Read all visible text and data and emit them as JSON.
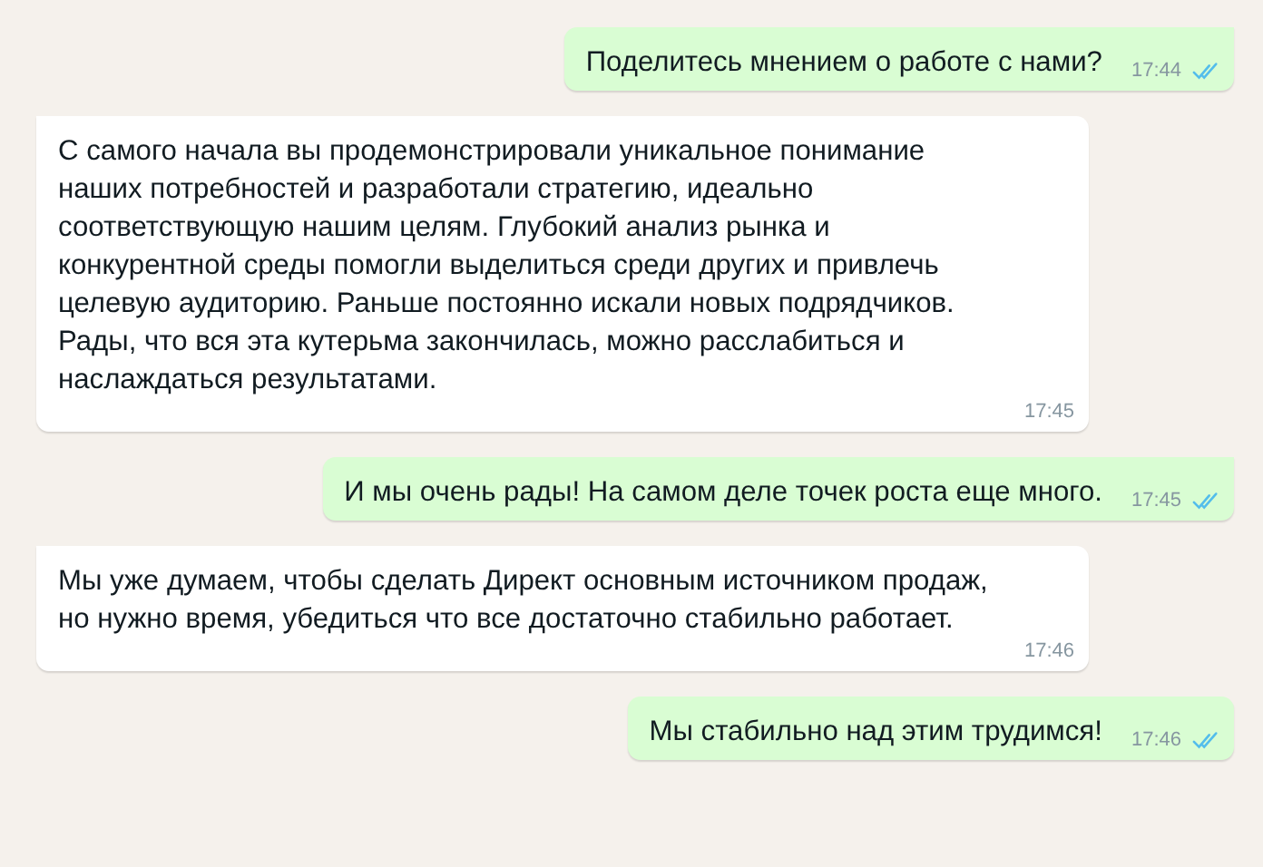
{
  "messages": [
    {
      "kind": "outgoing",
      "tail": true,
      "text": "Поделитесь мнением о работе с нами?",
      "time": "17:44",
      "read": true
    },
    {
      "kind": "incoming",
      "tail": true,
      "text": "С самого начала вы продемонстрировали уникальное понимание наших потребностей и разработали стратегию, идеально соответствующую нашим целям. Глубокий анализ рынка и конкурентной среды помогли выделиться среди других и привлечь целевую аудиторию. Раньше постоянно искали новых подрядчиков. Рады, что вся эта кутерьма закончилась, можно расслабиться и наслаждаться результатами.",
      "time": "17:45"
    },
    {
      "kind": "outgoing",
      "tail": true,
      "text": "И мы очень рады! На самом деле точек роста еще много.",
      "time": "17:45",
      "read": true
    },
    {
      "kind": "incoming",
      "tail": true,
      "text": "Мы уже думаем, чтобы сделать Директ основным источником продаж, но нужно время, убедиться что все достаточно стабильно работает.",
      "time": "17:46"
    },
    {
      "kind": "outgoing",
      "tail": false,
      "text": "Мы стабильно над этим трудимся!",
      "time": "17:46",
      "read": true
    }
  ]
}
